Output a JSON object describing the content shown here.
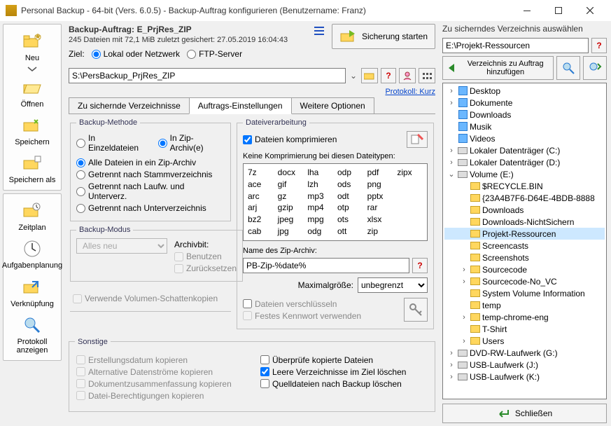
{
  "title": "Personal Backup - 64-bit (Vers. 6.0.5) - Backup-Auftrag konfigurieren (Benutzername: Franz)",
  "sidebar": {
    "items": [
      "Neu",
      "Öffnen",
      "Speichern",
      "Speichern als",
      "Zeitplan",
      "Aufgabenplanung",
      "Verknüpfung",
      "Protokoll anzeigen"
    ]
  },
  "job": {
    "title_label": "Backup-Auftrag:",
    "title_name": "E_PrjRes_ZIP",
    "meta": "245 Dateien mit 72,1 MiB   zuletzt gesichert:  27.05.2019 16:04:43",
    "target_label": "Ziel:",
    "target_local": "Lokal oder Netzwerk",
    "target_ftp": "FTP-Server",
    "start_btn": "Sicherung starten",
    "path": "S:\\PersBackup_PrjRes_ZIP",
    "protokoll": "Protokoll: Kurz"
  },
  "tabs": [
    "Zu sichernde Verzeichnisse",
    "Auftrags-Einstellungen",
    "Weitere Optionen"
  ],
  "method": {
    "legend": "Backup-Methode",
    "r1": "In Einzeldateien",
    "r2": "In Zip-Archiv(e)",
    "r3": "Alle Dateien in ein Zip-Archiv",
    "r4": "Getrennt nach Stammverzeichnis",
    "r5": "Getrennt nach Laufw. und Unterverz.",
    "r6": "Getrennt nach Unterverzeichnis"
  },
  "modus": {
    "legend": "Backup-Modus",
    "value": "Alles neu",
    "archivbit_label": "Archivbit:",
    "cb1": "Benutzen",
    "cb2": "Zurücksetzen"
  },
  "vss": "Verwende Volumen-Schattenkopien",
  "fileproc": {
    "legend": "Dateiverarbeitung",
    "compress": "Dateien komprimieren",
    "no_compress_label": "Keine Komprimierung bei diesen Dateitypen:",
    "types": [
      "7z",
      "docx",
      "lha",
      "odp",
      "pdf",
      "zipx",
      "ace",
      "gif",
      "lzh",
      "ods",
      "png",
      "",
      "arc",
      "gz",
      "mp3",
      "odt",
      "pptx",
      "",
      "arj",
      "gzip",
      "mp4",
      "otp",
      "rar",
      "",
      "bz2",
      "jpeg",
      "mpg",
      "ots",
      "xlsx",
      "",
      "cab",
      "jpg",
      "odg",
      "ott",
      "zip",
      ""
    ],
    "zip_name_label": "Name des Zip-Archiv:",
    "zip_name_value": "PB-Zip-%date%",
    "maxsize_label": "Maximalgröße:",
    "maxsize_value": "unbegrenzt",
    "encrypt": "Dateien verschlüsseln",
    "pwd": "Festes Kennwort verwenden"
  },
  "misc": {
    "legend": "Sonstige",
    "left": [
      "Erstellungsdatum kopieren",
      "Alternative Datenströme kopieren",
      "Dokumentzusammenfassung kopieren",
      "Datei-Berechtigungen kopieren"
    ],
    "right": [
      "Überprüfe kopierte Dateien",
      "Leere Verzeichnisse im Ziel löschen",
      "Quelldateien nach Backup löschen"
    ]
  },
  "right": {
    "title": "Zu sicherndes Verzeichnis auswählen",
    "path": "E:\\Projekt-Ressourcen",
    "add_btn": "Verzeichnis zu Auftrag hinzufügen",
    "close": "Schließen"
  },
  "tree": [
    {
      "d": 1,
      "tw": ">",
      "ic": "sys",
      "label": "Desktop"
    },
    {
      "d": 1,
      "tw": ">",
      "ic": "sys",
      "label": "Dokumente"
    },
    {
      "d": 1,
      "tw": "",
      "ic": "sys",
      "label": "Downloads"
    },
    {
      "d": 1,
      "tw": "",
      "ic": "sys",
      "label": "Musik"
    },
    {
      "d": 1,
      "tw": "",
      "ic": "sys",
      "label": "Videos"
    },
    {
      "d": 1,
      "tw": ">",
      "ic": "drive",
      "label": "Lokaler Datenträger (C:)"
    },
    {
      "d": 1,
      "tw": ">",
      "ic": "drive",
      "label": "Lokaler Datenträger (D:)"
    },
    {
      "d": 1,
      "tw": "v",
      "ic": "drive",
      "label": "Volume (E:)"
    },
    {
      "d": 2,
      "tw": "",
      "ic": "folder",
      "label": "$RECYCLE.BIN"
    },
    {
      "d": 2,
      "tw": "",
      "ic": "folder",
      "label": "{23A4B7F6-D64E-4BDB-8888"
    },
    {
      "d": 2,
      "tw": "",
      "ic": "folder",
      "label": "Downloads"
    },
    {
      "d": 2,
      "tw": "",
      "ic": "folder",
      "label": "Downloads-NichtSichern"
    },
    {
      "d": 2,
      "tw": "",
      "ic": "folder",
      "label": "Projekt-Ressourcen",
      "sel": true
    },
    {
      "d": 2,
      "tw": "",
      "ic": "folder",
      "label": "Screencasts"
    },
    {
      "d": 2,
      "tw": "",
      "ic": "folder",
      "label": "Screenshots"
    },
    {
      "d": 2,
      "tw": ">",
      "ic": "folder",
      "label": "Sourcecode"
    },
    {
      "d": 2,
      "tw": ">",
      "ic": "folder",
      "label": "Sourcecode-No_VC"
    },
    {
      "d": 2,
      "tw": "",
      "ic": "folder",
      "label": "System Volume Information"
    },
    {
      "d": 2,
      "tw": "",
      "ic": "folder",
      "label": "temp"
    },
    {
      "d": 2,
      "tw": ">",
      "ic": "folder",
      "label": "temp-chrome-eng"
    },
    {
      "d": 2,
      "tw": "",
      "ic": "folder",
      "label": "T-Shirt"
    },
    {
      "d": 2,
      "tw": ">",
      "ic": "folder",
      "label": "Users"
    },
    {
      "d": 1,
      "tw": ">",
      "ic": "drive",
      "label": "DVD-RW-Laufwerk (G:)"
    },
    {
      "d": 1,
      "tw": ">",
      "ic": "drive",
      "label": "USB-Laufwerk (J:)"
    },
    {
      "d": 1,
      "tw": ">",
      "ic": "drive",
      "label": "USB-Laufwerk (K:)"
    }
  ]
}
